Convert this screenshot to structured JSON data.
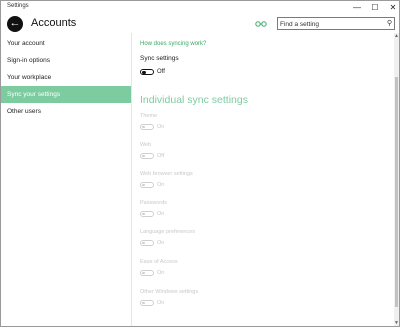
{
  "window": {
    "title": "Settings",
    "controls": {
      "minimize": "—",
      "maximize": "☐",
      "close": "✕"
    }
  },
  "header": {
    "title": "Accounts",
    "back_icon": "back-arrow-icon",
    "accent_icon": "glasses-icon",
    "search": {
      "placeholder": "Find a setting",
      "value": "",
      "icon": "search-icon"
    }
  },
  "sidebar": {
    "items": [
      {
        "label": "Your account",
        "selected": false
      },
      {
        "label": "Sign-in options",
        "selected": false
      },
      {
        "label": "Your workplace",
        "selected": false
      },
      {
        "label": "Sync your settings",
        "selected": true
      },
      {
        "label": "Other users",
        "selected": false
      }
    ]
  },
  "main": {
    "link": "How does syncing work?",
    "sync": {
      "label": "Sync settings",
      "state": "Off"
    },
    "section_heading": "Individual sync settings",
    "items": [
      {
        "label": "Theme",
        "state": "On"
      },
      {
        "label": "Web",
        "state": "Off"
      },
      {
        "label": "Web browser settings",
        "state": "On"
      },
      {
        "label": "Passwords",
        "state": "On"
      },
      {
        "label": "Language preferences",
        "state": "On"
      },
      {
        "label": "Ease of Access",
        "state": "On"
      },
      {
        "label": "Other Windows settings",
        "state": "On"
      }
    ]
  },
  "colors": {
    "accent": "#7dcca0",
    "link": "#3aa865",
    "disabled": "#c8c8c8"
  }
}
